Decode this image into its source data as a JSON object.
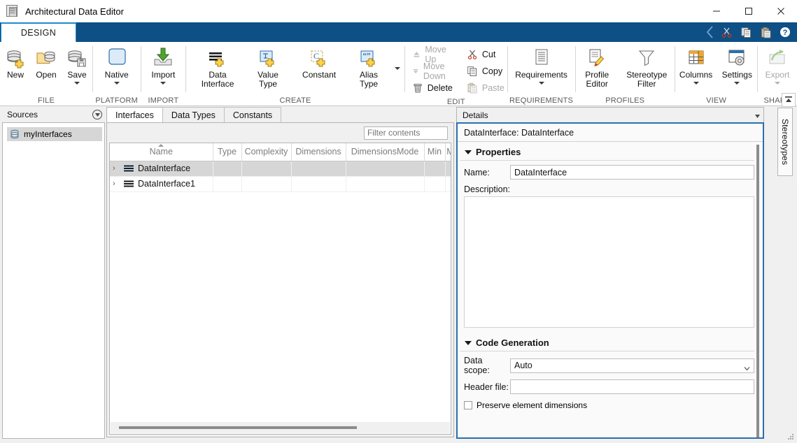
{
  "window": {
    "title": "Architectural Data Editor",
    "icon": "database-document-icon",
    "minimize": "minimize-icon",
    "maximize": "maximize-icon",
    "close": "close-icon"
  },
  "ribbon": {
    "tab": "DESIGN",
    "quick_access": [
      "cut-icon",
      "copy-icon",
      "paste-icon",
      "help-icon"
    ],
    "groups": [
      {
        "label": "FILE",
        "buttons": [
          {
            "label": "New",
            "icon": "database-new-icon",
            "dropdown": false,
            "enabled": true
          },
          {
            "label": "Open",
            "icon": "folder-open-icon",
            "dropdown": false,
            "enabled": true
          },
          {
            "label": "Save",
            "icon": "database-save-icon",
            "dropdown": true,
            "enabled": true
          }
        ]
      },
      {
        "label": "PLATFORM",
        "buttons": [
          {
            "label": "Native",
            "icon": "platform-square-icon",
            "dropdown": true,
            "enabled": true
          }
        ]
      },
      {
        "label": "IMPORT",
        "buttons": [
          {
            "label": "Import",
            "icon": "import-arrow-icon",
            "dropdown": true,
            "enabled": true
          }
        ]
      },
      {
        "label": "CREATE",
        "buttons": [
          {
            "label": "Data\nInterface",
            "icon": "data-interface-add-icon",
            "dropdown": false,
            "enabled": true
          },
          {
            "label": "Value\nType",
            "icon": "value-type-add-icon",
            "dropdown": false,
            "enabled": true
          },
          {
            "label": "Constant",
            "icon": "constant-add-icon",
            "dropdown": false,
            "enabled": true
          },
          {
            "label": "Alias\nType",
            "icon": "alias-type-add-icon",
            "dropdown": false,
            "enabled": true
          }
        ],
        "overflow": "more-icon"
      },
      {
        "label": "EDIT",
        "small_columns": [
          [
            {
              "label": "Move Up",
              "icon": "arrow-up-icon",
              "enabled": false
            },
            {
              "label": "Move Down",
              "icon": "arrow-down-icon",
              "enabled": false
            },
            {
              "label": "Delete",
              "icon": "trash-icon",
              "enabled": true
            }
          ],
          [
            {
              "label": "Cut",
              "icon": "cut-icon",
              "enabled": true
            },
            {
              "label": "Copy",
              "icon": "copy-icon",
              "enabled": true
            },
            {
              "label": "Paste",
              "icon": "paste-icon",
              "enabled": false
            }
          ]
        ]
      },
      {
        "label": "REQUIREMENTS",
        "buttons": [
          {
            "label": "Requirements",
            "icon": "requirements-doc-icon",
            "dropdown": true,
            "enabled": true
          }
        ]
      },
      {
        "label": "PROFILES",
        "buttons": [
          {
            "label": "Profile\nEditor",
            "icon": "profile-editor-icon",
            "dropdown": true,
            "enabled": true,
            "inline_caret": true
          },
          {
            "label": "Stereotype\nFilter",
            "icon": "funnel-filter-icon",
            "dropdown": true,
            "enabled": true,
            "inline_caret": true
          }
        ]
      },
      {
        "label": "VIEW",
        "buttons": [
          {
            "label": "Columns",
            "icon": "columns-table-icon",
            "dropdown": true,
            "enabled": true
          },
          {
            "label": "Settings",
            "icon": "settings-gear-icon",
            "dropdown": true,
            "enabled": true
          }
        ]
      },
      {
        "label": "SHARE",
        "buttons": [
          {
            "label": "Export",
            "icon": "export-share-icon",
            "dropdown": true,
            "enabled": false
          }
        ]
      }
    ],
    "collapse": "collapse-ribbon-icon"
  },
  "sources": {
    "title": "Sources",
    "collapse_icon": "panel-options-icon",
    "items": [
      {
        "label": "myInterfaces",
        "icon": "database-icon",
        "selected": true
      }
    ]
  },
  "center": {
    "tabs": [
      {
        "label": "Interfaces",
        "active": true
      },
      {
        "label": "Data Types",
        "active": false
      },
      {
        "label": "Constants",
        "active": false
      }
    ],
    "filter": {
      "value": "",
      "placeholder": "Filter contents"
    },
    "grid": {
      "columns": [
        "Name",
        "Type",
        "Complexity",
        "Dimensions",
        "DimensionsMode",
        "Min",
        "Max"
      ],
      "sorted_column": "Name",
      "sort_direction": "ascending",
      "rows": [
        {
          "name": "DataInterface",
          "icon": "interface-icon",
          "expander": "chevron-right-icon",
          "selected": true,
          "type": "",
          "complexity": "",
          "dimensions": "",
          "dimensions_mode": "",
          "min": "",
          "max": ""
        },
        {
          "name": "DataInterface1",
          "icon": "interface-icon",
          "expander": "chevron-right-icon",
          "selected": false,
          "type": "",
          "complexity": "",
          "dimensions": "",
          "dimensions_mode": "",
          "min": "",
          "max": ""
        }
      ]
    }
  },
  "details": {
    "title": "Details",
    "collapse_icon": "panel-options-icon",
    "subject": "DataInterface: DataInterface",
    "sections": [
      {
        "heading": "Properties",
        "name_label": "Name:",
        "name_value": "DataInterface",
        "description_label": "Description:",
        "description_value": ""
      },
      {
        "heading": "Code Generation",
        "data_scope_label": "Data scope:",
        "data_scope_value": "Auto",
        "header_file_label": "Header file:",
        "header_file_value": "",
        "preserve_label": "Preserve element dimensions",
        "preserve_checked": false
      }
    ]
  },
  "stereotypes_tab": {
    "label": "Stereotypes"
  },
  "colors": {
    "ribbon_tabstrip": "#0e4f85",
    "tab_accent": "#1b8ad1",
    "details_border": "#2c6fad",
    "selection": "#d6d6d6",
    "panel_bg": "#f0f0f0"
  }
}
